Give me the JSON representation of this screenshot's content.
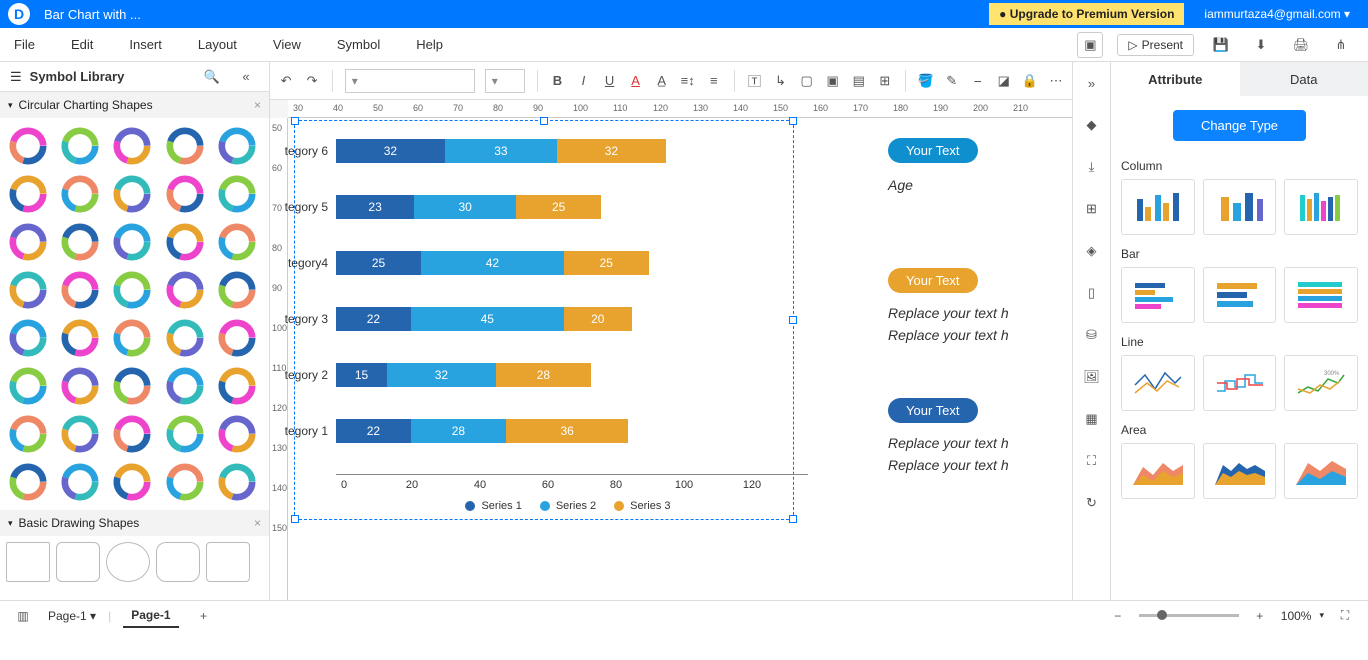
{
  "topbar": {
    "doc_title": "Bar Chart with ...",
    "upgrade": "● Upgrade to Premium Version",
    "user": "iammurtaza4@gmail.com"
  },
  "menu": {
    "file": "File",
    "edit": "Edit",
    "insert": "Insert",
    "layout": "Layout",
    "view": "View",
    "symbol": "Symbol",
    "help": "Help",
    "present": "Present"
  },
  "left": {
    "library": "Symbol Library",
    "section1": "Circular Charting Shapes",
    "section2": "Basic Drawing Shapes"
  },
  "right": {
    "tab_attr": "Attribute",
    "tab_data": "Data",
    "change": "Change Type",
    "column": "Column",
    "bar": "Bar",
    "line": "Line",
    "area": "Area"
  },
  "canvas": {
    "pill1": "Your Text",
    "pill2": "Your Text",
    "pill3": "Your Text",
    "age": "Age",
    "rep1": "Replace your text h",
    "rep2": "Replace your text h",
    "rep3": "Replace your text h",
    "rep4": "Replace your text h"
  },
  "chart_data": {
    "type": "bar",
    "orientation": "horizontal",
    "categories": [
      "tegory 6",
      "tegory 5",
      "tegory4",
      "tegory 3",
      "tegory 2",
      "tegory 1"
    ],
    "series": [
      {
        "name": "Series 1",
        "color": "#2565ae",
        "values": [
          32,
          23,
          25,
          22,
          15,
          22
        ]
      },
      {
        "name": "Series 2",
        "color": "#29a3e0",
        "values": [
          33,
          30,
          42,
          45,
          32,
          28
        ]
      },
      {
        "name": "Series 3",
        "color": "#e8a22e",
        "values": [
          32,
          25,
          25,
          20,
          28,
          36
        ]
      }
    ],
    "xaxis": [
      0,
      20,
      40,
      60,
      80,
      100,
      120
    ],
    "legend": [
      "Series 1",
      "Series 2",
      "Series 3"
    ]
  },
  "ruler_h": [
    "30",
    "40",
    "50",
    "60",
    "70",
    "80",
    "90",
    "100",
    "110",
    "120",
    "130",
    "140",
    "150",
    "160",
    "170",
    "180",
    "190",
    "200",
    "210"
  ],
  "ruler_v": [
    "50",
    "60",
    "70",
    "80",
    "90",
    "100",
    "110",
    "120",
    "130",
    "140",
    "150"
  ],
  "pages": {
    "select": "Page-1",
    "tab": "Page-1"
  },
  "zoom": "100%"
}
